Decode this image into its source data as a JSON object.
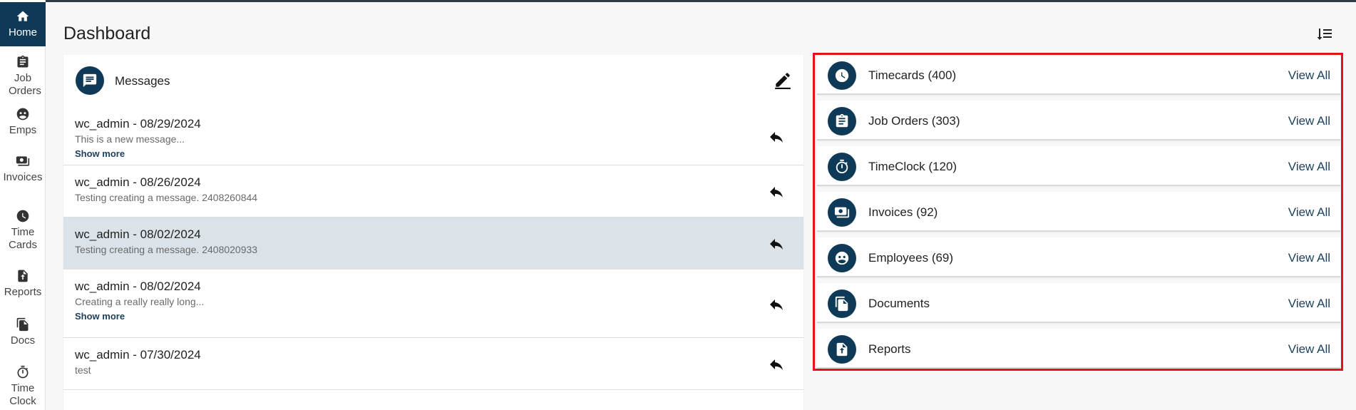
{
  "sidebar": {
    "items": [
      {
        "label": "Home",
        "icon": "home-icon",
        "active": true
      },
      {
        "label": "Job Orders",
        "icon": "clipboard-icon"
      },
      {
        "label": "Emps",
        "icon": "people-icon"
      },
      {
        "label": "Invoices",
        "icon": "money-icon"
      },
      {
        "label": "Time Cards",
        "icon": "clock-icon"
      },
      {
        "label": "Reports",
        "icon": "upload-file-icon"
      },
      {
        "label": "Docs",
        "icon": "documents-icon"
      },
      {
        "label": "Time Clock",
        "icon": "stopwatch-icon"
      }
    ]
  },
  "header": {
    "title": "Dashboard",
    "sort_icon": "sort-lines-icon"
  },
  "messages": {
    "title": "Messages",
    "header_icon": "chat-icon",
    "compose_icon": "edit-icon",
    "items": [
      {
        "from": "wc_admin - 08/29/2024",
        "body": "This is a new message...",
        "show_more": "Show more"
      },
      {
        "from": "wc_admin - 08/26/2024",
        "body": "Testing creating a message. 2408260844"
      },
      {
        "from": "wc_admin - 08/02/2024",
        "body": "Testing creating a message. 2408020933",
        "selected": true
      },
      {
        "from": "wc_admin - 08/02/2024",
        "body": "Creating a really really long...",
        "show_more": "Show more"
      },
      {
        "from": "wc_admin - 07/30/2024",
        "body": "test"
      }
    ]
  },
  "summary": {
    "view_all_label": "View All",
    "items": [
      {
        "label": "Timecards (400)",
        "icon": "clock-icon"
      },
      {
        "label": "Job Orders (303)",
        "icon": "clipboard-icon"
      },
      {
        "label": "TimeClock (120)",
        "icon": "stopwatch-icon"
      },
      {
        "label": "Invoices (92)",
        "icon": "money-icon"
      },
      {
        "label": "Employees (69)",
        "icon": "people-icon"
      },
      {
        "label": "Documents",
        "icon": "documents-icon"
      },
      {
        "label": "Reports",
        "icon": "upload-file-icon"
      }
    ]
  },
  "colors": {
    "primary": "#0f3a57",
    "highlight_border": "#e3131b",
    "selected_row": "#dbe3e8",
    "link": "#1b3f5c"
  }
}
